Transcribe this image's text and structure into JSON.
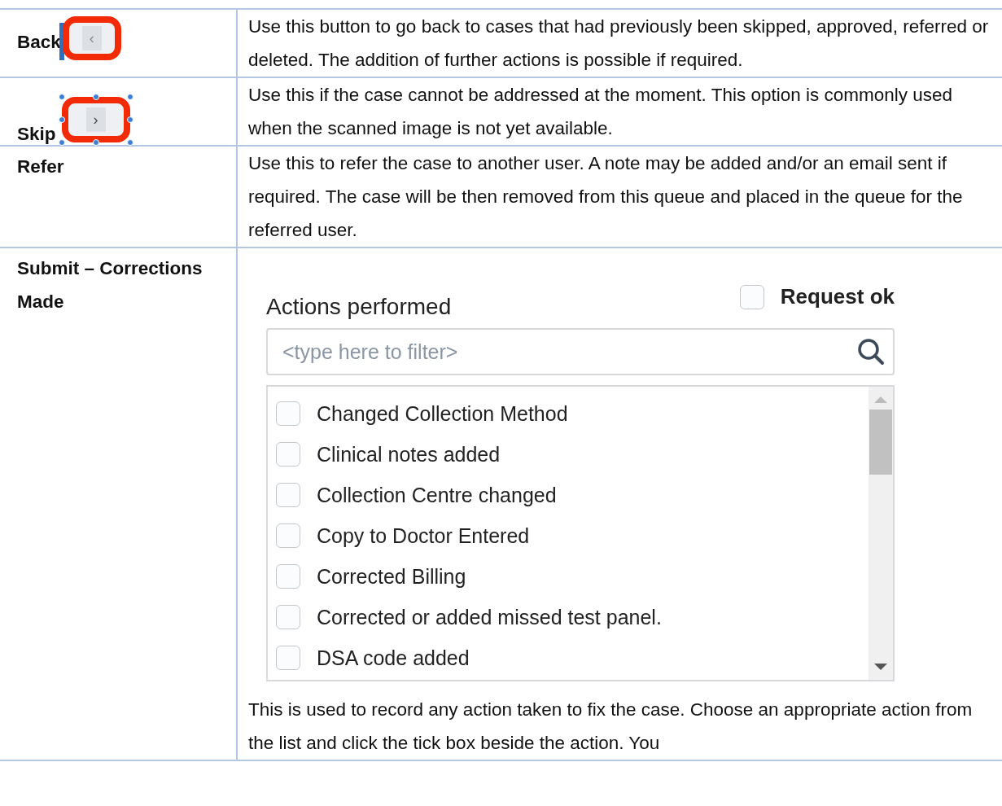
{
  "rows": [
    {
      "kind": "back",
      "label": "Back",
      "button_glyph": "‹",
      "description": "Use this button to go back to cases that had previously been skipped, approved, referred or deleted. The addition of  further actions is possible if required."
    },
    {
      "kind": "skip",
      "label": "Skip",
      "button_glyph": "›",
      "description": "Use this if the case cannot be addressed at the moment. This option is commonly used when the scanned image is not yet available."
    },
    {
      "kind": "refer",
      "label": "Refer",
      "description": "Use this to refer the case to another user. A note may be added and/or an email sent if required. The case will be then removed from this queue and placed in the queue for the referred user."
    },
    {
      "kind": "submit",
      "label": "Submit – Corrections Made",
      "panel": {
        "title": "Actions performed",
        "request_ok": {
          "label": "Request ok",
          "checked": false
        },
        "filter": {
          "placeholder": "<type here to filter>"
        },
        "actions": [
          {
            "label": "Changed Collection Method",
            "checked": false
          },
          {
            "label": "Clinical notes added",
            "checked": false
          },
          {
            "label": "Collection Centre changed",
            "checked": false
          },
          {
            "label": "Copy to Doctor Entered",
            "checked": false
          },
          {
            "label": "Corrected Billing",
            "checked": false
          },
          {
            "label": "Corrected or added missed test panel.",
            "checked": false
          },
          {
            "label": "DSA code added",
            "checked": false
          }
        ]
      },
      "description": "This is used to record any action taken to fix the case. Choose an appropriate action from the list and click the tick box beside the action. You"
    }
  ]
}
